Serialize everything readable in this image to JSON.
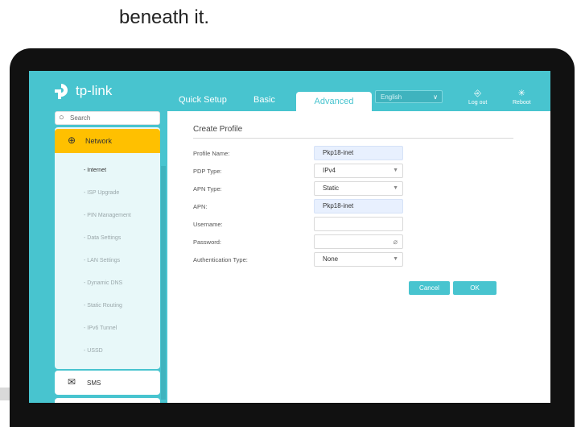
{
  "caption": "beneath it.",
  "header": {
    "brand": "tp-link",
    "tabs": [
      "Quick Setup",
      "Basic",
      "Advanced"
    ],
    "active_tab": "Advanced",
    "language": "English",
    "logout_label": "Log out",
    "reboot_label": "Reboot"
  },
  "sidebar": {
    "search_placeholder": "Search",
    "network_label": "Network",
    "items": [
      {
        "label": "- Internet"
      },
      {
        "label": "- ISP Upgrade"
      },
      {
        "label": "- PIN Management"
      },
      {
        "label": "- Data Settings"
      },
      {
        "label": "- LAN Settings"
      },
      {
        "label": "- Dynamic DNS"
      },
      {
        "label": "- Static Routing"
      },
      {
        "label": "- IPv6 Tunnel"
      },
      {
        "label": "- USSD"
      }
    ],
    "sms_label": "SMS"
  },
  "form": {
    "title": "Create Profile",
    "fields": [
      {
        "label": "Profile Name:",
        "value": "Pkp18-inet"
      },
      {
        "label": "PDP Type:",
        "value": "IPv4"
      },
      {
        "label": "APN Type:",
        "value": "Static"
      },
      {
        "label": "APN:",
        "value": "Pkp18-inet"
      },
      {
        "label": "Username:",
        "value": ""
      },
      {
        "label": "Password:",
        "value": ""
      },
      {
        "label": "Authentication Type:",
        "value": "None"
      }
    ],
    "cancel_label": "Cancel",
    "ok_label": "OK"
  },
  "colors": {
    "accent": "#48c4cf",
    "highlight": "#ffc000"
  }
}
